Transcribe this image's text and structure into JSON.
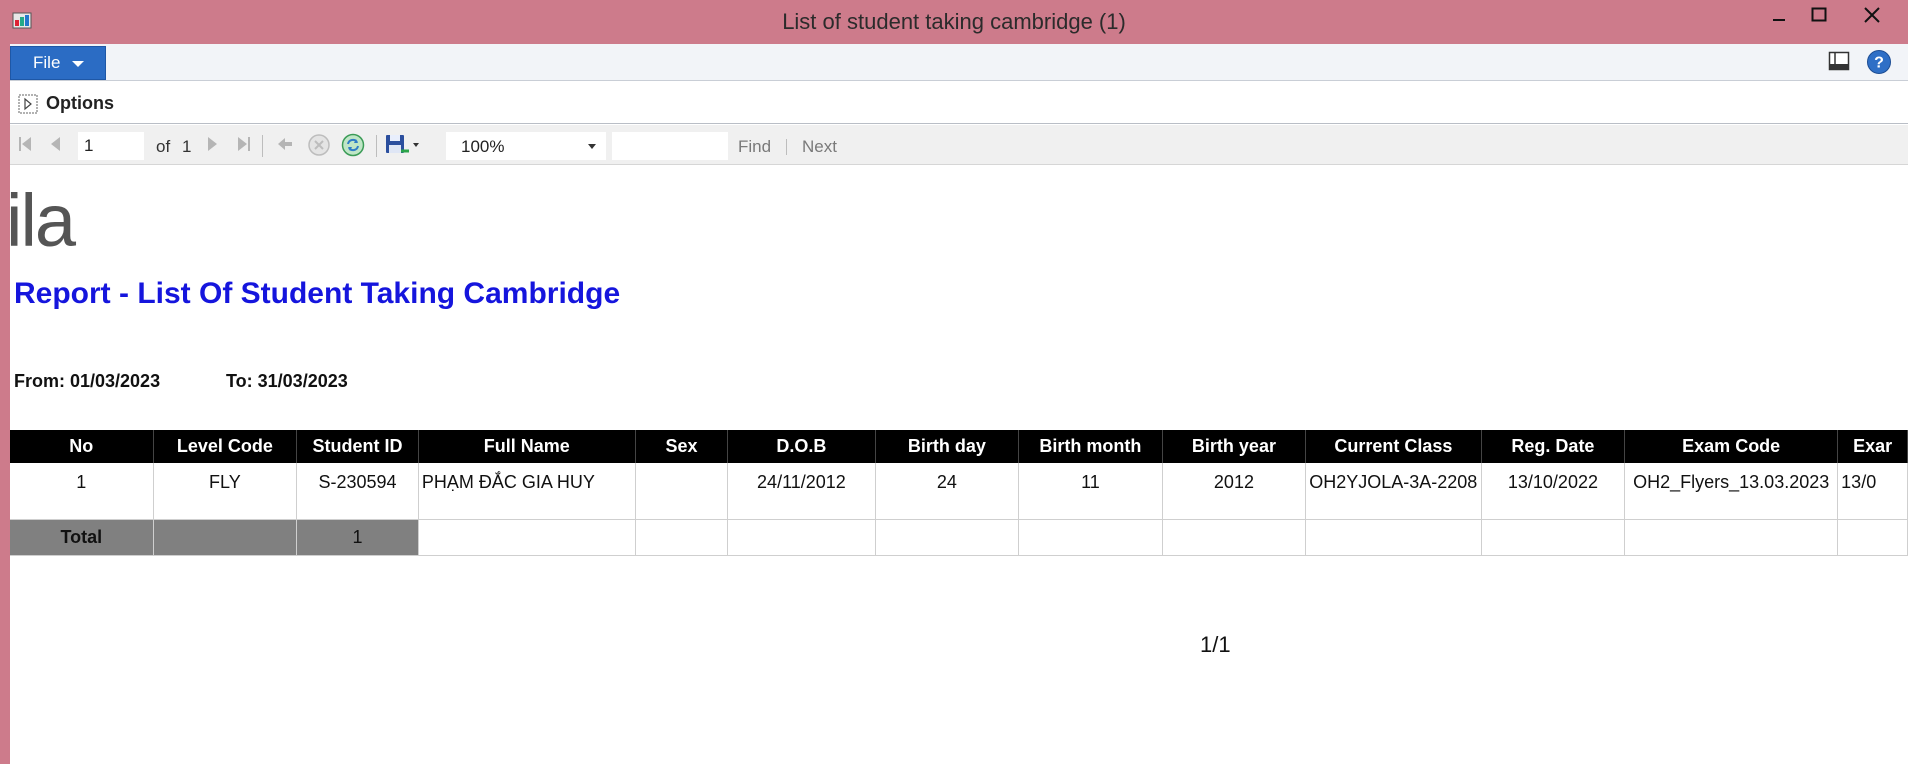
{
  "window": {
    "title": "List of student taking cambridge (1)"
  },
  "menu": {
    "file_label": "File"
  },
  "options": {
    "label": "Options"
  },
  "toolbar": {
    "page_value": "1",
    "of_label": "of",
    "total_pages": "1",
    "zoom_value": "100%",
    "find_label": "Find",
    "next_label": "Next"
  },
  "report": {
    "logo_text": "ila",
    "title": "Report - List Of Student Taking Cambridge",
    "from_label": "From: 01/03/2023",
    "to_label": "To: 31/03/2023",
    "columns": [
      "No",
      "Level Code",
      "Student ID",
      "Full Name",
      "Sex",
      "D.O.B",
      "Birth day",
      "Birth month",
      "Birth year",
      "Current Class",
      "Reg. Date",
      "Exam Code",
      "Exar"
    ],
    "rows": [
      [
        "1",
        "FLY",
        "S-230594",
        "PHẠM ĐẮC GIA HUY",
        "",
        "24/11/2012",
        "24",
        "11",
        "2012",
        "OH2YJOLA-3A-2208",
        "13/10/2022",
        "OH2_Flyers_13.03.2023",
        "13/0"
      ]
    ],
    "total_row": {
      "label": "Total",
      "level": "",
      "count": "1"
    },
    "page_indicator": "1/1"
  },
  "colors": {
    "titlebar": "#cd7b8b",
    "file_button": "#2b6cc4",
    "report_title": "#1515dd",
    "header_bg": "#000000",
    "total_bg": "#808080"
  }
}
